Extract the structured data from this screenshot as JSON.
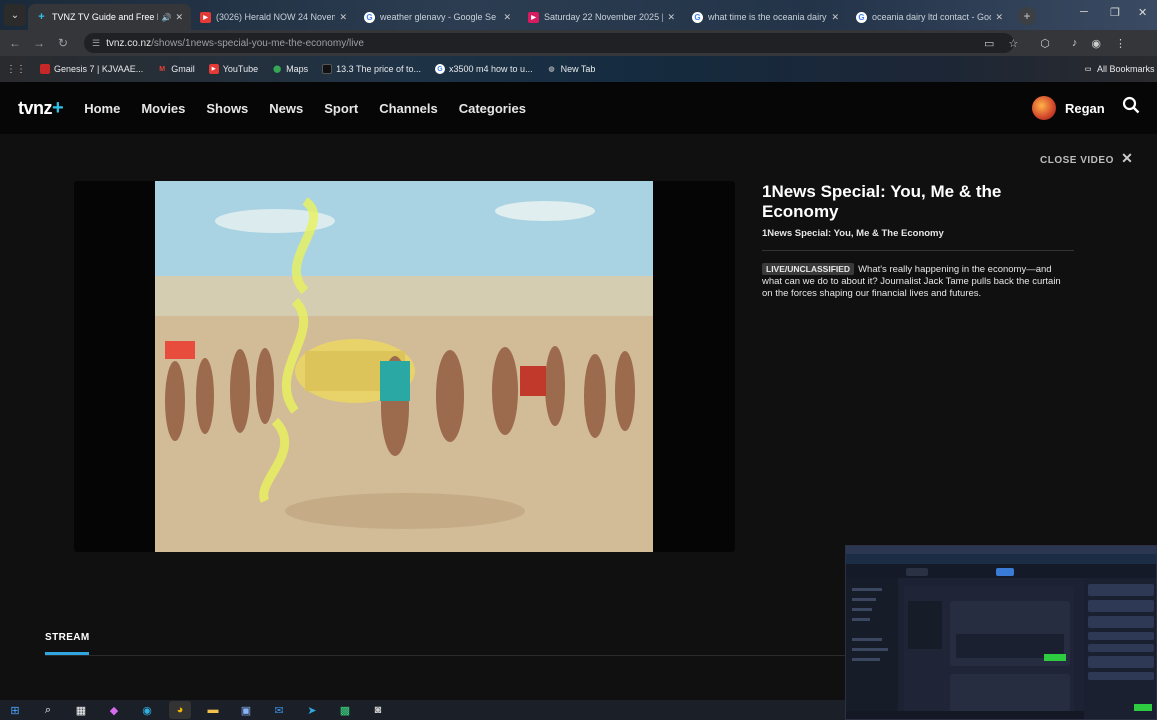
{
  "browser": {
    "tabs": [
      {
        "title": "TVNZ TV Guide and Free Li",
        "favicon": "tvnz-icon",
        "active": true
      },
      {
        "title": "(3026) Herald NOW 24 Novem",
        "favicon": "youtube-icon",
        "active": false
      },
      {
        "title": "weather glenavy - Google Se",
        "favicon": "google-icon",
        "active": false
      },
      {
        "title": "Saturday 22 November 2025 |",
        "favicon": "play-icon",
        "active": false
      },
      {
        "title": "what time is the oceania dairy",
        "favicon": "google-icon",
        "active": false
      },
      {
        "title": "oceania dairy ltd contact - Goo",
        "favicon": "google-icon",
        "active": false
      }
    ],
    "url_site": "tvnz.co.nz",
    "url_path": "/shows/1news-special-you-me-the-economy/live",
    "bookmarks": [
      {
        "label": "Genesis 7 | KJVAAE...",
        "icon": "bookmark-red-icon"
      },
      {
        "label": "Gmail",
        "icon": "gmail-icon"
      },
      {
        "label": "YouTube",
        "icon": "youtube-icon"
      },
      {
        "label": "Maps",
        "icon": "maps-icon"
      },
      {
        "label": "13.3 The price of to...",
        "icon": "bookmark-dark-icon"
      },
      {
        "label": "x3500 m4 how to u...",
        "icon": "google-icon"
      },
      {
        "label": "New Tab",
        "icon": "globe-icon"
      }
    ],
    "all_bookmarks": "All Bookmarks"
  },
  "site": {
    "logo": "tvnz",
    "logo_plus": "+",
    "nav": [
      "Home",
      "Movies",
      "Shows",
      "News",
      "Sport",
      "Channels",
      "Categories"
    ],
    "user_name": "Regan"
  },
  "video_page": {
    "close_label": "CLOSE VIDEO",
    "title": "1News Special: You, Me & the Economy",
    "subtitle": "1News Special: You, Me & The Economy",
    "badge": "LIVE/UNCLASSIFIED",
    "description": "What's really happening in the economy—and what can we do to about it? Journalist Jack Tame pulls back the curtain on the forces shaping our financial lives and futures.",
    "stream_tab": "STREAM"
  },
  "colors": {
    "accent": "#2fa6e0",
    "logo_plus": "#2fc3e6",
    "header_bg": "#060606",
    "page_bg": "#101010"
  }
}
